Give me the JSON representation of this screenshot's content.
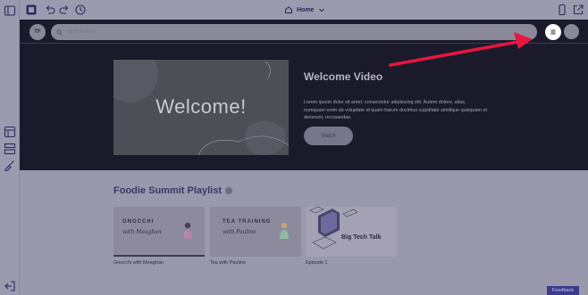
{
  "toolbar": {
    "page_name": "Home"
  },
  "navbar": {
    "logo_initials": "TF",
    "search_placeholder": "Search here"
  },
  "hero": {
    "thumbnail_text": "Welcome!",
    "title": "Welcome Video",
    "description": "Lorem ipsum dolor sit amet, consectetur adipisicing elit. Autem dolore, alias, numquam enim ab voluptate id quam harum ducimus cupiditate similique quisquam et deserunt, recusandae.",
    "button_label": "Watch"
  },
  "playlist": {
    "title": "Foodie Summit Playlist",
    "cards": [
      {
        "thumb_line1": "GNOCCHI",
        "thumb_line2": "with Meaghan",
        "caption": "Gnocchi with Meaghan"
      },
      {
        "thumb_line1": "TEA TRAINING",
        "thumb_line2": "with Pauline",
        "caption": "Tea with Pauline"
      },
      {
        "thumb_line1": "Big Tech Talk",
        "caption": "Episode 1"
      }
    ]
  },
  "feedback_label": "Feedback",
  "colors": {
    "overlay": "#9a98ad",
    "hero_bg": "#1b1a2b",
    "annotation_arrow": "#e8163f",
    "feedback_bg": "#3a3b8c"
  }
}
